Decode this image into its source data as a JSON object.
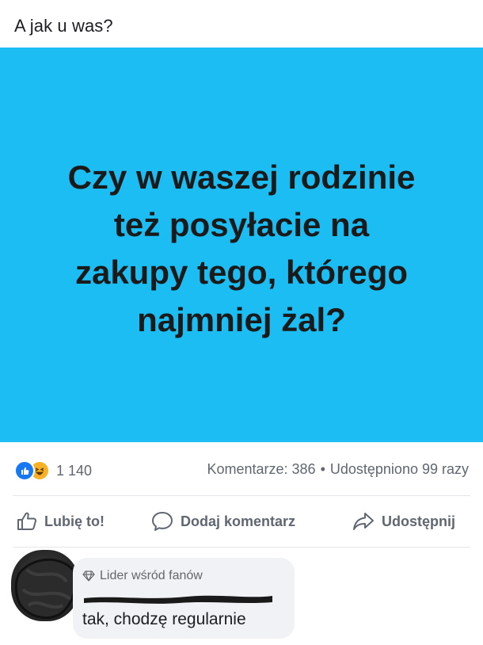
{
  "post": {
    "caption": "A jak u was?",
    "image_text_lines": [
      "Czy w waszej rodzinie",
      "też posyłacie na",
      "zakupy tego, którego",
      "najmniej żal?"
    ],
    "image_background": "#1bbdf2"
  },
  "stats": {
    "reaction_icons": [
      "like-icon",
      "haha-icon"
    ],
    "reaction_count": "1 140",
    "comments": "Komentarze: 386",
    "separator": "•",
    "shares": "Udostępniono 99 razy"
  },
  "actions": {
    "like_label": "Lubię to!",
    "comment_label": "Dodaj komentarz",
    "share_label": "Udostępnij"
  },
  "comment": {
    "badge_icon": "diamond-icon",
    "badge_label": "Lider wśród fanów",
    "author_name_redacted": true,
    "text": "tak, chodzę regularnie"
  },
  "colors": {
    "brand_blue": "#1877f2",
    "meta_text": "#606770",
    "bubble_bg": "#f0f2f5"
  }
}
